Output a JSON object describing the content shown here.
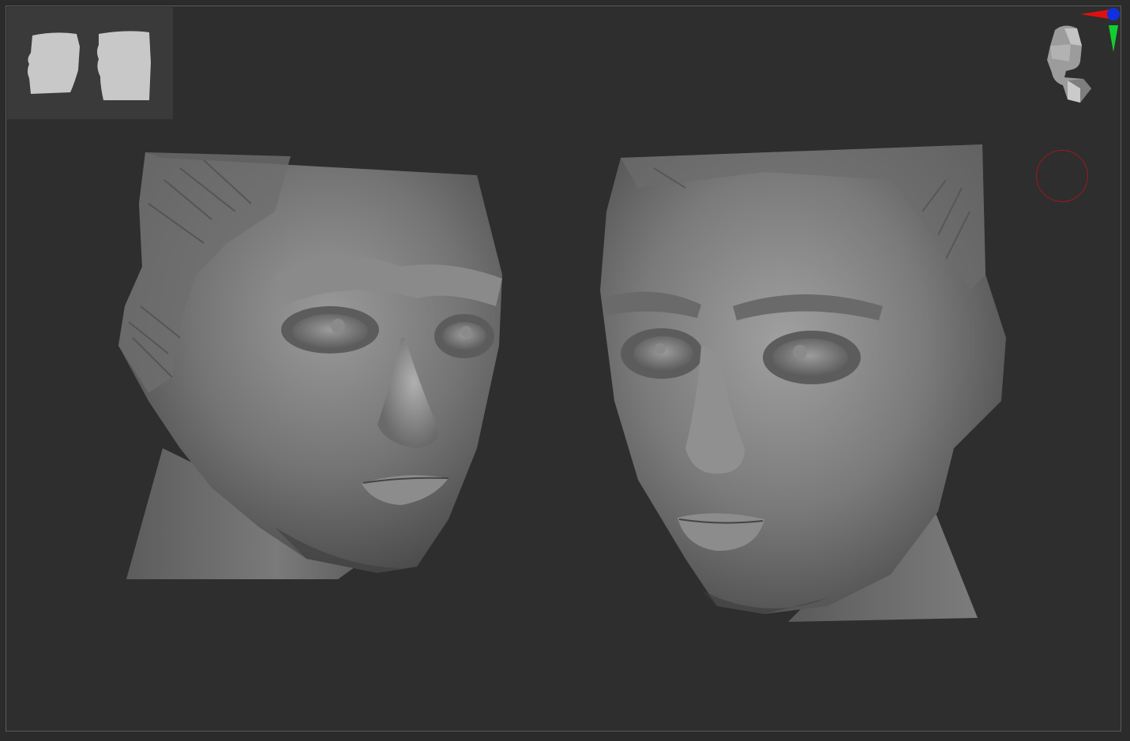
{
  "viewport": {
    "background": "#2e2e2e",
    "border_color": "#5a5a5a"
  },
  "thumbnail_panel": {
    "views": [
      "head-left-silhouette",
      "head-right-silhouette"
    ],
    "silhouette_color": "#c8c8c8"
  },
  "models": [
    {
      "name": "sculpt-head-three-quarter-left"
    },
    {
      "name": "sculpt-head-three-quarter-right"
    }
  ],
  "navigator": {
    "axes": {
      "x": "#e01010",
      "y": "#10d030",
      "z": "#1030e0"
    }
  },
  "brush": {
    "color": "#a01818"
  }
}
